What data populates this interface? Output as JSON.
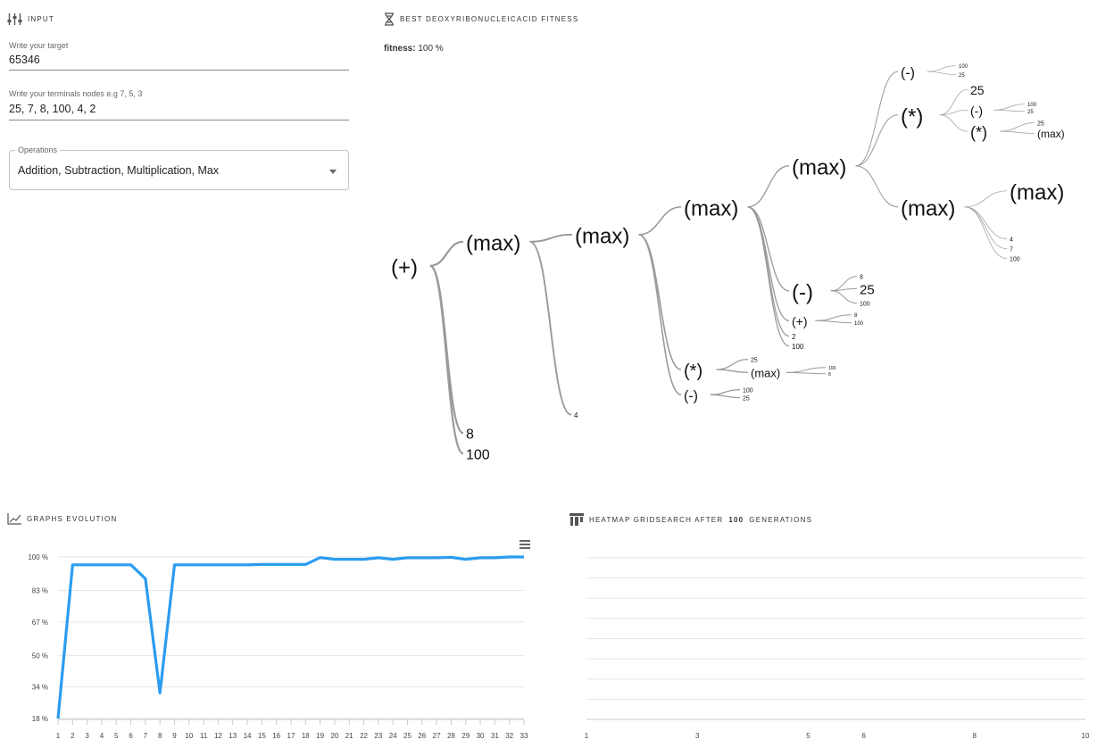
{
  "input": {
    "section_title": "INPUT",
    "target_label": "Write your target",
    "target_value": "65346",
    "terminals_label": "Write your terminals nodes e.g 7, 5, 3",
    "terminals_value": "25, 7, 8, 100, 4, 2",
    "operations_legend": "Operations",
    "operations_value": "Addition, Subtraction, Multiplication, Max"
  },
  "fitness_panel": {
    "section_title": "BEST DEOXYRIBONUCLEICACID FITNESS",
    "fitness_label": "fitness:",
    "fitness_value": "100 %"
  },
  "tree": {
    "name": "(+)",
    "children": [
      {
        "name": "(max)",
        "children": [
          {
            "name": "(max)",
            "children": [
              {
                "name": "(max)",
                "children": [
                  {
                    "name": "(max)",
                    "children": [
                      {
                        "name": "(-)",
                        "children": [
                          {
                            "name": "100"
                          },
                          {
                            "name": "25"
                          }
                        ]
                      },
                      {
                        "name": "(*)",
                        "children": [
                          {
                            "name": "25"
                          },
                          {
                            "name": "(-)",
                            "children": [
                              {
                                "name": "100"
                              },
                              {
                                "name": "25"
                              }
                            ]
                          },
                          {
                            "name": "(*)",
                            "children": [
                              {
                                "name": "25"
                              },
                              {
                                "name": "(max)"
                              }
                            ]
                          }
                        ]
                      },
                      {
                        "name": "(max)",
                        "children": [
                          {
                            "name": "(max)"
                          },
                          {
                            "name": "4"
                          },
                          {
                            "name": "7"
                          },
                          {
                            "name": "100"
                          }
                        ]
                      }
                    ]
                  },
                  {
                    "name": "(-)",
                    "children": [
                      {
                        "name": "8"
                      },
                      {
                        "name": "25"
                      },
                      {
                        "name": "100"
                      }
                    ]
                  },
                  {
                    "name": "(+)",
                    "children": [
                      {
                        "name": "8"
                      },
                      {
                        "name": "100"
                      }
                    ]
                  },
                  {
                    "name": "2"
                  },
                  {
                    "name": "100"
                  }
                ]
              },
              {
                "name": "(*)",
                "children": [
                  {
                    "name": "25"
                  },
                  {
                    "name": "(max)",
                    "children": [
                      {
                        "name": "100"
                      },
                      {
                        "name": "8"
                      }
                    ]
                  }
                ]
              },
              {
                "name": "(-)",
                "children": [
                  {
                    "name": "100"
                  },
                  {
                    "name": "25"
                  }
                ]
              }
            ]
          },
          {
            "name": "4"
          }
        ]
      },
      {
        "name": "8"
      },
      {
        "name": "100"
      }
    ]
  },
  "evolution": {
    "section_title": "GRAPHS EVOLUTION",
    "menu_icon": "hamburger-menu-icon",
    "line_color": "#2b9cf0"
  },
  "heatmap": {
    "section_title_prefix": "HEATMAP GRIDSEARCH AFTER",
    "section_title_count": "100",
    "section_title_suffix": "GENERATIONS"
  },
  "chart_data": [
    {
      "type": "line",
      "title": "",
      "xlabel": "",
      "ylabel": "",
      "categories": [
        "1",
        "2",
        "3",
        "4",
        "5",
        "6",
        "7",
        "8",
        "9",
        "10",
        "11",
        "12",
        "13",
        "14",
        "15",
        "16",
        "17",
        "18",
        "19",
        "20",
        "21",
        "22",
        "23",
        "24",
        "25",
        "26",
        "27",
        "28",
        "29",
        "30",
        "31",
        "32",
        "33"
      ],
      "y_ticks": [
        "18 %",
        "34 %",
        "50 %",
        "67 %",
        "83 %",
        "100 %"
      ],
      "ylim": [
        18,
        100
      ],
      "grid": true,
      "series": [
        {
          "values": [
            18,
            96,
            96,
            96,
            96,
            96,
            89,
            31,
            96,
            96,
            96,
            96,
            96,
            96,
            96.2,
            96.2,
            96.2,
            96.2,
            99.7,
            98.8,
            98.8,
            98.8,
            99.6,
            98.8,
            99.6,
            99.6,
            99.6,
            99.8,
            98.8,
            99.6,
            99.6,
            100,
            100
          ]
        }
      ]
    },
    {
      "type": "heatmap",
      "title": "",
      "x_ticks": [
        "1",
        "3",
        "5",
        "6",
        "8",
        "10"
      ],
      "xlim": [
        1,
        10
      ],
      "rows": 9,
      "grid": true,
      "values": []
    }
  ]
}
